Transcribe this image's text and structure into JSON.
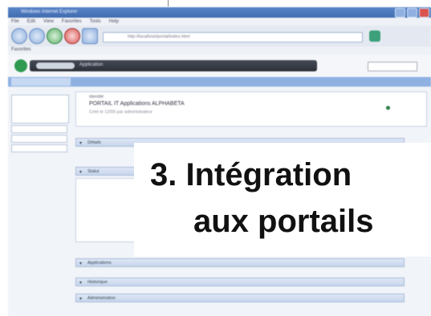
{
  "window": {
    "title": "Windows Internet Explorer"
  },
  "menubar": {
    "items": [
      "File",
      "Edit",
      "View",
      "Favorites",
      "Tools",
      "Help"
    ]
  },
  "navbar": {
    "address": "http://localhost/portal/index.html"
  },
  "favorites": {
    "label": "Favorites"
  },
  "app": {
    "breadcrumb": "Application"
  },
  "card": {
    "label": "Identité",
    "title": "PORTAIL IT Applications ALPHABETA",
    "subtitle": "Créé le 12/05 par administrateur"
  },
  "sections": [
    "Détails",
    "Statut",
    "Applications",
    "Historique",
    "Administration"
  ],
  "overlay": {
    "line1": "3. Intégration",
    "line2": "aux portails"
  },
  "colors": {
    "accent": "#8fb1e2",
    "titlebar": "#3f6ab0",
    "logo": "#2f9a51"
  }
}
